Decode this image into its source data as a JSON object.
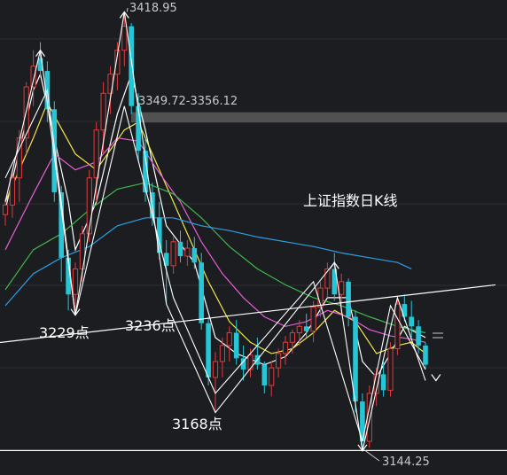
{
  "chart_data": {
    "type": "candlestick",
    "title": "上证指数日K线",
    "high_label": "3418.95",
    "low_label": "3144.25",
    "gap_label": "3349.72-3356.12",
    "point_labels": [
      "3229点",
      "3236点",
      "3168点"
    ],
    "y_axis": {
      "min": 3140,
      "max": 3422
    },
    "gap_zone": [
      3349.72,
      3356.12
    ],
    "colors": {
      "up": "#e03b3b",
      "down": "#27c6d6",
      "ma5": "#ffffff",
      "ma10": "#f3e84a",
      "ma20": "#e65ed2",
      "ma30": "#3fb84a",
      "ma60": "#2b9fe6",
      "gap": "#5a5a5a",
      "trend": "#ffffff"
    },
    "candles": [
      [
        3292,
        3302,
        3285,
        3298
      ],
      [
        3298,
        3320,
        3290,
        3315
      ],
      [
        3315,
        3345,
        3300,
        3340
      ],
      [
        3340,
        3375,
        3330,
        3372
      ],
      [
        3372,
        3395,
        3360,
        3385
      ],
      [
        3390,
        3400,
        3378,
        3382
      ],
      [
        3382,
        3388,
        3350,
        3358
      ],
      [
        3358,
        3363,
        3300,
        3306
      ],
      [
        3306,
        3310,
        3250,
        3265
      ],
      [
        3265,
        3270,
        3232,
        3242
      ],
      [
        3242,
        3262,
        3229,
        3258
      ],
      [
        3258,
        3285,
        3250,
        3280
      ],
      [
        3280,
        3320,
        3275,
        3315
      ],
      [
        3315,
        3350,
        3300,
        3345
      ],
      [
        3345,
        3375,
        3330,
        3368
      ],
      [
        3368,
        3385,
        3355,
        3380
      ],
      [
        3380,
        3400,
        3370,
        3395
      ],
      [
        3395,
        3419,
        3385,
        3410
      ],
      [
        3410,
        3412,
        3355,
        3360
      ],
      [
        3360,
        3368,
        3325,
        3332
      ],
      [
        3332,
        3340,
        3300,
        3306
      ],
      [
        3306,
        3312,
        3285,
        3290
      ],
      [
        3290,
        3300,
        3264,
        3268
      ],
      [
        3268,
        3276,
        3236,
        3260
      ],
      [
        3260,
        3278,
        3255,
        3275
      ],
      [
        3275,
        3282,
        3262,
        3266
      ],
      [
        3266,
        3276,
        3260,
        3271
      ],
      [
        3271,
        3278,
        3258,
        3262
      ],
      [
        3262,
        3268,
        3220,
        3224
      ],
      [
        3224,
        3228,
        3185,
        3190
      ],
      [
        3190,
        3206,
        3168,
        3200
      ],
      [
        3200,
        3215,
        3190,
        3210
      ],
      [
        3210,
        3222,
        3200,
        3218
      ],
      [
        3218,
        3226,
        3198,
        3202
      ],
      [
        3202,
        3210,
        3188,
        3195
      ],
      [
        3195,
        3208,
        3190,
        3204
      ],
      [
        3204,
        3215,
        3195,
        3198
      ],
      [
        3198,
        3200,
        3180,
        3185
      ],
      [
        3185,
        3200,
        3178,
        3196
      ],
      [
        3196,
        3208,
        3190,
        3205
      ],
      [
        3205,
        3216,
        3198,
        3212
      ],
      [
        3212,
        3220,
        3205,
        3218
      ],
      [
        3218,
        3226,
        3210,
        3222
      ],
      [
        3222,
        3230,
        3215,
        3219
      ],
      [
        3219,
        3238,
        3212,
        3234
      ],
      [
        3234,
        3250,
        3228,
        3246
      ],
      [
        3246,
        3262,
        3240,
        3258
      ],
      [
        3258,
        3268,
        3238,
        3242
      ],
      [
        3242,
        3255,
        3230,
        3250
      ],
      [
        3250,
        3252,
        3222,
        3228
      ],
      [
        3228,
        3232,
        3168,
        3175
      ],
      [
        3175,
        3180,
        3144,
        3150
      ],
      [
        3150,
        3185,
        3146,
        3180
      ],
      [
        3180,
        3196,
        3172,
        3192
      ],
      [
        3192,
        3200,
        3178,
        3182
      ],
      [
        3182,
        3212,
        3178,
        3208
      ],
      [
        3208,
        3240,
        3204,
        3236
      ],
      [
        3236,
        3242,
        3225,
        3228
      ],
      [
        3228,
        3238,
        3215,
        3222
      ],
      [
        3222,
        3226,
        3205,
        3210
      ],
      [
        3210,
        3212,
        3195,
        3198
      ]
    ],
    "ma_lines": {
      "ma5": [
        [
          0,
          3295
        ],
        [
          4,
          3370
        ],
        [
          5,
          3380
        ],
        [
          9,
          3300
        ],
        [
          10,
          3270
        ],
        [
          13,
          3300
        ],
        [
          16,
          3355
        ],
        [
          18,
          3380
        ],
        [
          20,
          3345
        ],
        [
          23,
          3285
        ],
        [
          27,
          3262
        ],
        [
          30,
          3215
        ],
        [
          33,
          3205
        ],
        [
          37,
          3198
        ],
        [
          40,
          3203
        ],
        [
          43,
          3218
        ],
        [
          46,
          3240
        ],
        [
          49,
          3240
        ],
        [
          51,
          3200
        ],
        [
          53,
          3190
        ],
        [
          55,
          3205
        ],
        [
          57,
          3222
        ],
        [
          60,
          3215
        ]
      ],
      "ma10": [
        [
          0,
          3300
        ],
        [
          4,
          3340
        ],
        [
          6,
          3362
        ],
        [
          10,
          3330
        ],
        [
          13,
          3320
        ],
        [
          17,
          3345
        ],
        [
          19,
          3350
        ],
        [
          22,
          3320
        ],
        [
          26,
          3280
        ],
        [
          29,
          3250
        ],
        [
          32,
          3225
        ],
        [
          35,
          3212
        ],
        [
          38,
          3205
        ],
        [
          41,
          3208
        ],
        [
          44,
          3218
        ],
        [
          47,
          3232
        ],
        [
          50,
          3225
        ],
        [
          53,
          3205
        ],
        [
          56,
          3210
        ],
        [
          58,
          3212
        ],
        [
          60,
          3205
        ]
      ],
      "ma20": [
        [
          0,
          3270
        ],
        [
          4,
          3305
        ],
        [
          7,
          3330
        ],
        [
          10,
          3320
        ],
        [
          13,
          3325
        ],
        [
          16,
          3340
        ],
        [
          19,
          3338
        ],
        [
          22,
          3318
        ],
        [
          25,
          3300
        ],
        [
          28,
          3275
        ],
        [
          31,
          3255
        ],
        [
          34,
          3240
        ],
        [
          37,
          3228
        ],
        [
          40,
          3222
        ],
        [
          43,
          3225
        ],
        [
          46,
          3232
        ],
        [
          49,
          3228
        ],
        [
          52,
          3220
        ],
        [
          55,
          3216
        ],
        [
          58,
          3214
        ],
        [
          60,
          3212
        ]
      ],
      "ma30": [
        [
          0,
          3245
        ],
        [
          4,
          3270
        ],
        [
          8,
          3280
        ],
        [
          12,
          3295
        ],
        [
          16,
          3308
        ],
        [
          20,
          3312
        ],
        [
          24,
          3305
        ],
        [
          28,
          3290
        ],
        [
          32,
          3272
        ],
        [
          36,
          3258
        ],
        [
          40,
          3248
        ],
        [
          44,
          3240
        ],
        [
          48,
          3235
        ],
        [
          52,
          3228
        ],
        [
          56,
          3222
        ],
        [
          60,
          3218
        ]
      ],
      "ma60": [
        [
          0,
          3235
        ],
        [
          4,
          3255
        ],
        [
          8,
          3265
        ],
        [
          12,
          3272
        ],
        [
          16,
          3285
        ],
        [
          20,
          3290
        ],
        [
          24,
          3290
        ],
        [
          28,
          3285
        ],
        [
          32,
          3282
        ],
        [
          36,
          3278
        ],
        [
          40,
          3275
        ],
        [
          44,
          3272
        ],
        [
          48,
          3268
        ],
        [
          52,
          3265
        ],
        [
          56,
          3262
        ],
        [
          58,
          3258
        ]
      ]
    },
    "trend_paths": [
      [
        [
          0,
          3300
        ],
        [
          5,
          3395
        ],
        [
          10,
          3229
        ],
        [
          17,
          3419
        ],
        [
          23,
          3236
        ],
        [
          30,
          3168
        ],
        [
          47,
          3262
        ],
        [
          51,
          3144
        ],
        [
          56,
          3240
        ],
        [
          60,
          3188
        ]
      ],
      [
        [
          0,
          3315
        ],
        [
          6,
          3370
        ],
        [
          10,
          3229
        ],
        [
          17,
          3360
        ],
        [
          24,
          3240
        ],
        [
          30,
          3180
        ],
        [
          44,
          3250
        ],
        [
          51,
          3150
        ],
        [
          55,
          3235
        ],
        [
          60,
          3195
        ]
      ]
    ],
    "neckline": [
      [
        -2.5,
        3211
      ],
      [
        70,
        3248
      ]
    ],
    "support": 3144.25
  }
}
